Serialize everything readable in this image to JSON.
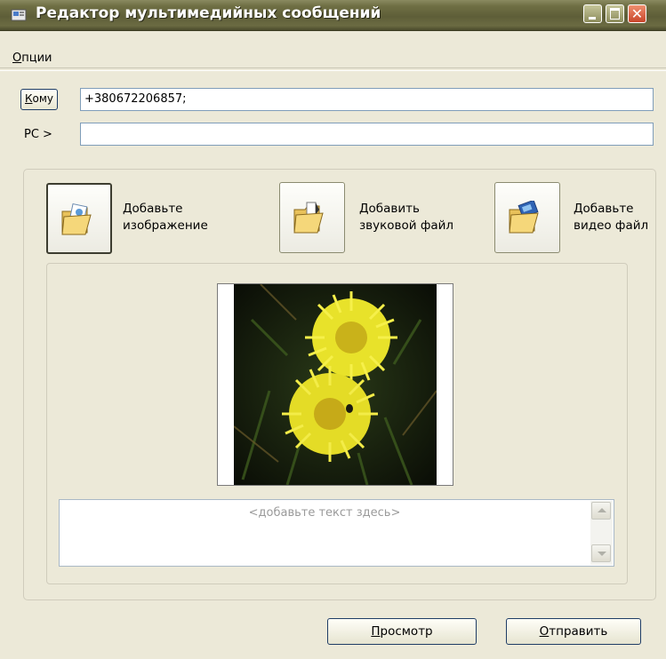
{
  "window": {
    "title": "Редактор мультимедийных сообщений"
  },
  "menu": {
    "options_first": "О",
    "options_rest": "пции"
  },
  "recipient": {
    "to_button_first": "К",
    "to_button_rest": "ому",
    "to_value": "+380672206857;",
    "rs_label": "РС >",
    "rs_value": ""
  },
  "media_buttons": {
    "image_line1": "Добавьте",
    "image_line2": "изображение",
    "sound_line1": "Добавить",
    "sound_line2": "звуковой файл",
    "video_line1": "Добавьте",
    "video_line2": "видео файл"
  },
  "message": {
    "placeholder": "<добавьте текст здесь>"
  },
  "actions": {
    "preview_first": "П",
    "preview_rest": "росмотр",
    "send_first": "О",
    "send_rest": "тправить"
  },
  "icons": {
    "app": "mms-app-icon",
    "image": "folder-picture-icon",
    "sound": "folder-music-icon",
    "video": "folder-video-icon"
  },
  "colors": {
    "titlebar": "#6b6b42",
    "window_bg": "#ece9d8",
    "close_button": "#d9553a"
  }
}
